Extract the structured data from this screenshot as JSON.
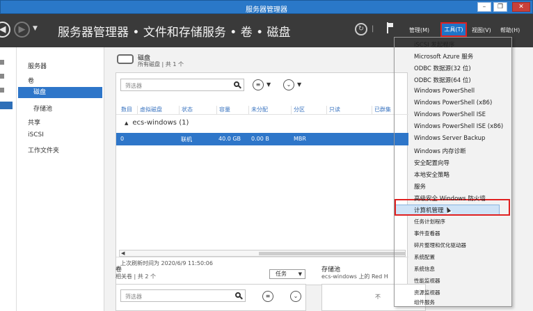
{
  "window": {
    "title": "服务器管理器",
    "minimize": "–",
    "maximize": "❐",
    "close": "✕"
  },
  "nav": {
    "breadcrumb": "服务器管理器 • 文件和存储服务 • 卷 • 磁盘",
    "menus": [
      "管理(M)",
      "工具(T)",
      "视图(V)",
      "帮助(H)"
    ]
  },
  "sidebar": {
    "items": [
      "服务器",
      "卷",
      "磁盘",
      "存储池",
      "共享",
      "iSCSI",
      "工作文件夹"
    ]
  },
  "disks_panel": {
    "title": "磁盘",
    "subtitle": "所有磁盘 | 共 1 个",
    "filter_placeholder": "筛选器",
    "columns": [
      "数目",
      "虚拟磁盘",
      "状态",
      "容量",
      "未分配",
      "分区",
      "只读",
      "已群集"
    ],
    "group": "ecs-windows (1)",
    "row": [
      "0",
      "",
      "联机",
      "40.0 GB",
      "0.00 B",
      "MBR"
    ],
    "last_refresh": "上次刷新时间为 2020/6/9 11:50:06"
  },
  "volumes_panel": {
    "title": "卷",
    "subtitle": "相关卷 | 共 2 个",
    "tasks": "任务",
    "filter_placeholder": "筛选器"
  },
  "storage_pool_panel": {
    "title": "存储池",
    "subtitle": "ecs-windows 上的 Red H",
    "content": "不"
  },
  "tools_menu": {
    "items": [
      "iSCSI 发起程序",
      "Microsoft Azure 服务",
      "ODBC 数据源(32 位)",
      "ODBC 数据源(64 位)",
      "Windows PowerShell",
      "Windows PowerShell (x86)",
      "Windows PowerShell ISE",
      "Windows PowerShell ISE (x86)",
      "Windows Server Backup",
      "Windows 内存诊断",
      "安全配置向导",
      "本地安全策略",
      "服务",
      "高级安全 Windows 防火墙",
      "计算机管理",
      "任务计划程序",
      "事件查看器",
      "碎片整理和优化驱动器",
      "系统配置",
      "系统信息",
      "性能监视器",
      "资源监视器",
      "组件服务"
    ]
  },
  "colors": {
    "titlebar": "#2a78c8",
    "navbar": "#3a3a3a",
    "selection": "#2e76c9",
    "highlight_border": "#e02020"
  }
}
